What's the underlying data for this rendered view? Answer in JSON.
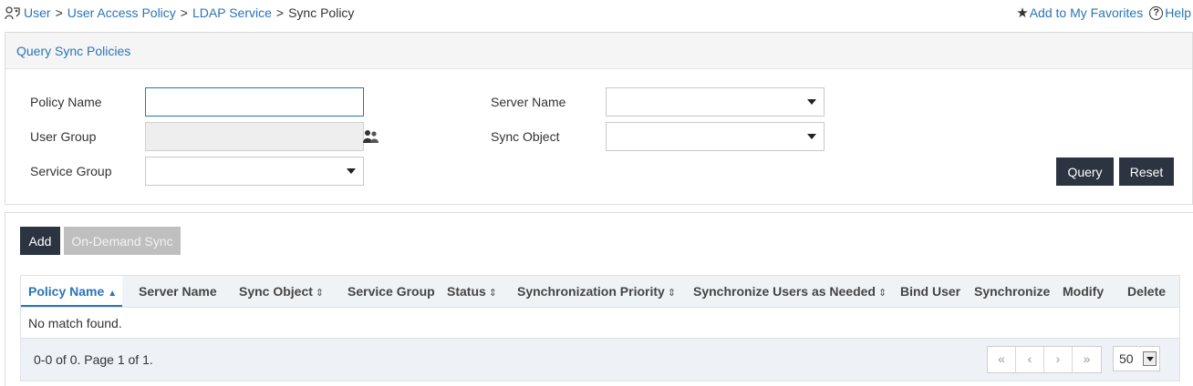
{
  "breadcrumb": {
    "items": [
      "User",
      "User Access Policy",
      "LDAP Service"
    ],
    "separator": ">",
    "current": "Sync Policy"
  },
  "topbar": {
    "favorites": "Add to My Favorites",
    "help": "Help"
  },
  "query": {
    "title": "Query Sync Policies",
    "labels": {
      "policy_name": "Policy Name",
      "user_group": "User Group",
      "service_group": "Service Group",
      "server_name": "Server Name",
      "sync_object": "Sync Object"
    },
    "values": {
      "policy_name": "",
      "user_group": "",
      "service_group": "",
      "server_name": "",
      "sync_object": ""
    },
    "query_btn": "Query",
    "reset_btn": "Reset"
  },
  "toolbar": {
    "add": "Add",
    "on_demand_sync": "On-Demand Sync"
  },
  "table": {
    "columns": [
      "Policy Name",
      "Server Name",
      "Sync Object",
      "Service Group",
      "Status",
      "Synchronization Priority",
      "Synchronize Users as Needed",
      "Bind User",
      "Synchronize",
      "Modify",
      "Delete"
    ],
    "sort_up": "▲",
    "sort_both": "⇕",
    "empty": "No match found."
  },
  "pagination": {
    "summary": "0-0 of 0. Page 1 of 1.",
    "first": "«",
    "prev": "‹",
    "next": "›",
    "last": "»",
    "page_size": "50"
  },
  "colors": {
    "link": "#2a74b9",
    "button_dark": "#2b3440",
    "button_disabled": "#bfbfbf"
  }
}
